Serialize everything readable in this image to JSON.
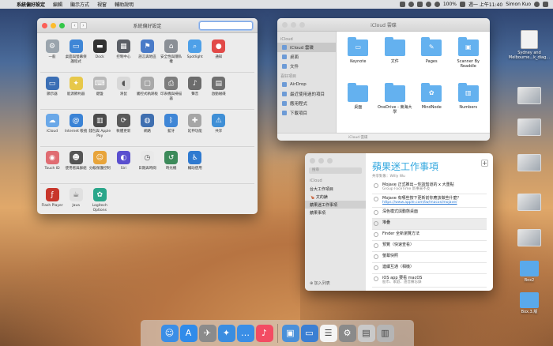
{
  "menubar": {
    "apple": "",
    "items": [
      "系統偏好設定",
      "編輯",
      "顯示方式",
      "視窗",
      "輔助說明"
    ],
    "status_battery": "100%",
    "clock": "週一 上午11:40",
    "user": "Simon Kuo"
  },
  "prefs": {
    "title": "系統偏好設定",
    "back": "‹",
    "forward": "›",
    "sections": [
      [
        {
          "label": "一般",
          "icon": "general-icon",
          "color": "#9aa4ad",
          "glyph": "⚙"
        },
        {
          "label": "桌面與螢幕保護程式",
          "icon": "desktop-icon",
          "color": "#3f86d6",
          "glyph": "▭"
        },
        {
          "label": "Dock",
          "icon": "dock-icon",
          "color": "#333333",
          "glyph": "▬"
        },
        {
          "label": "控制中心",
          "icon": "mission-control-icon",
          "color": "#5b5f66",
          "glyph": "▦"
        },
        {
          "label": "語言與地區",
          "icon": "language-icon",
          "color": "#4a7bc8",
          "glyph": "⚑"
        },
        {
          "label": "安全性與隱私權",
          "icon": "security-icon",
          "color": "#8a8f96",
          "glyph": "⌂"
        },
        {
          "label": "Spotlight",
          "icon": "spotlight-icon",
          "color": "#4ea0e8",
          "glyph": "⌕"
        },
        {
          "label": "通知",
          "icon": "notifications-icon",
          "color": "#e24a48",
          "glyph": "●"
        },
        {
          "label": "",
          "icon": "empty",
          "color": "transparent",
          "glyph": ""
        }
      ],
      [
        {
          "label": "顯示器",
          "icon": "displays-icon",
          "color": "#3b6fb5",
          "glyph": "▭"
        },
        {
          "label": "能源節約器",
          "icon": "energy-icon",
          "color": "#e7c84a",
          "glyph": "✦"
        },
        {
          "label": "鍵盤",
          "icon": "keyboard-icon",
          "color": "#b9b9b9",
          "glyph": "⌨"
        },
        {
          "label": "滑鼠",
          "icon": "mouse-icon",
          "color": "#d8d8d8",
          "glyph": "◖"
        },
        {
          "label": "觸控式軌跡板",
          "icon": "trackpad-icon",
          "color": "#a9a9a9",
          "glyph": "▢"
        },
        {
          "label": "印表機與掃描器",
          "icon": "printers-icon",
          "color": "#7d7d7d",
          "glyph": "⎙"
        },
        {
          "label": "聲音",
          "icon": "sound-icon",
          "color": "#6c6c6c",
          "glyph": "♪"
        },
        {
          "label": "啟動磁碟",
          "icon": "startup-disk-icon",
          "color": "#6f6f6f",
          "glyph": "▤"
        },
        {
          "label": "",
          "icon": "empty",
          "color": "transparent",
          "glyph": ""
        }
      ],
      [
        {
          "label": "iCloud",
          "icon": "icloud-icon",
          "color": "#6aa8e8",
          "glyph": "☁"
        },
        {
          "label": "Internet 帳號",
          "icon": "internet-accounts-icon",
          "color": "#3a83d6",
          "glyph": "@"
        },
        {
          "label": "錢包與 Apple Pay",
          "icon": "wallet-icon",
          "color": "#4b4b4b",
          "glyph": "▥"
        },
        {
          "label": "軟體更新",
          "icon": "software-update-icon",
          "color": "#5a5a5a",
          "glyph": "⟳"
        },
        {
          "label": "網路",
          "icon": "network-icon",
          "color": "#3f6fb0",
          "glyph": "◍"
        },
        {
          "label": "藍牙",
          "icon": "bluetooth-icon",
          "color": "#3f86d6",
          "glyph": "ᛒ"
        },
        {
          "label": "延伸功能",
          "icon": "extensions-icon",
          "color": "#a6a6a6",
          "glyph": "✚"
        },
        {
          "label": "共享",
          "icon": "sharing-icon",
          "color": "#3f8fd6",
          "glyph": "⚠"
        },
        {
          "label": "",
          "icon": "empty",
          "color": "transparent",
          "glyph": ""
        }
      ],
      [
        {
          "label": "Touch ID",
          "icon": "touch-id-icon",
          "color": "#e06c72",
          "glyph": "◉"
        },
        {
          "label": "使用者與群組",
          "icon": "users-icon",
          "color": "#555555",
          "glyph": "☻"
        },
        {
          "label": "分級保護控制",
          "icon": "parental-icon",
          "color": "#e8a43a",
          "glyph": "☺"
        },
        {
          "label": "Siri",
          "icon": "siri-icon",
          "color": "#5a4fcf",
          "glyph": "◐"
        },
        {
          "label": "日期與時間",
          "icon": "date-time-icon",
          "color": "#e9e9e9",
          "glyph": "◷"
        },
        {
          "label": "時光機",
          "icon": "time-machine-icon",
          "color": "#3c8a5a",
          "glyph": "↺"
        },
        {
          "label": "輔助使用",
          "icon": "accessibility-icon",
          "color": "#2f7ad0",
          "glyph": "♿"
        },
        {
          "label": "",
          "icon": "empty",
          "color": "transparent",
          "glyph": ""
        },
        {
          "label": "",
          "icon": "empty",
          "color": "transparent",
          "glyph": ""
        }
      ],
      [
        {
          "label": "Flash Player",
          "icon": "flash-icon",
          "color": "#c8362b",
          "glyph": "ƒ"
        },
        {
          "label": "Java",
          "icon": "java-icon",
          "color": "#e0e0e0",
          "glyph": "☕"
        },
        {
          "label": "Logitech Options",
          "icon": "logitech-icon",
          "color": "#2aa68a",
          "glyph": "✿"
        },
        {
          "label": "",
          "icon": "empty",
          "color": "transparent",
          "glyph": ""
        },
        {
          "label": "",
          "icon": "empty",
          "color": "transparent",
          "glyph": ""
        },
        {
          "label": "",
          "icon": "empty",
          "color": "transparent",
          "glyph": ""
        },
        {
          "label": "",
          "icon": "empty",
          "color": "transparent",
          "glyph": ""
        },
        {
          "label": "",
          "icon": "empty",
          "color": "transparent",
          "glyph": ""
        },
        {
          "label": "",
          "icon": "empty",
          "color": "transparent",
          "glyph": ""
        }
      ]
    ]
  },
  "finder": {
    "title": "iCloud 雲碟",
    "sidebar": [
      {
        "type": "header",
        "label": "iCloud"
      },
      {
        "type": "item",
        "label": "iCloud 雲碟",
        "selected": true
      },
      {
        "type": "item",
        "label": "桌面"
      },
      {
        "type": "item",
        "label": "文件"
      },
      {
        "type": "header",
        "label": "喜好項目"
      },
      {
        "type": "item",
        "label": "AirDrop"
      },
      {
        "type": "item",
        "label": "最近使用過的項目"
      },
      {
        "type": "item",
        "label": "應用程式"
      },
      {
        "type": "item",
        "label": "下載項目"
      }
    ],
    "items": [
      {
        "label": "Keynote",
        "glyph": "▭"
      },
      {
        "label": "文件",
        "glyph": ""
      },
      {
        "label": "Pages",
        "glyph": "✎"
      },
      {
        "label": "Scanner By Readdle",
        "glyph": "▣"
      },
      {
        "label": "桌面",
        "glyph": ""
      },
      {
        "label": "OneDrive - 東海大學",
        "glyph": ""
      },
      {
        "label": "MindNode",
        "glyph": "✿"
      },
      {
        "label": "Numbers",
        "glyph": "▥"
      }
    ],
    "status": "iCloud 雲碟"
  },
  "reminders": {
    "title": "蘋果迷工作事項",
    "subtitle": "共享對象：Willy Wu",
    "search_placeholder": "搜尋",
    "group_icloud": "iCloud",
    "lists": [
      "台大工作項目",
      "🍗 文的錶",
      "蘋果迷工作事項",
      "蘋果事項"
    ],
    "selected_list": 2,
    "add_list": "⊕ 加入列表",
    "tasks": [
      {
        "text": "Mojave 正式推出－你該知道的 x 大重點",
        "note": "Group FaceTime 新事來不及",
        "link": ""
      },
      {
        "text": "Mojave 有哪些按下更新前你應該做些什麼？",
        "note": "",
        "link": "https://www.apple.com/tw/macos/mojave/"
      },
      {
        "text": "深色模式與動態桌面",
        "note": "",
        "link": ""
      },
      {
        "text": "堆疊",
        "note": "",
        "link": ""
      },
      {
        "text": "Finder 全新瀏覽方法",
        "note": "",
        "link": ""
      },
      {
        "text": "預覽（快速查看）",
        "note": "",
        "link": ""
      },
      {
        "text": "螢幕快照",
        "note": "",
        "link": ""
      },
      {
        "text": "連續互通（相機）",
        "note": "",
        "link": ""
      },
      {
        "text": "iOS app 要看 macOS",
        "note": "股市、家庭、語音備忘錄",
        "link": ""
      }
    ]
  },
  "desktop": [
    {
      "label": "Sydney and Melbourne...k_diag...",
      "kind": "doc"
    },
    {
      "label": "",
      "kind": "image"
    },
    {
      "label": "",
      "kind": "image"
    },
    {
      "label": "",
      "kind": "image"
    },
    {
      "label": "",
      "kind": "image"
    },
    {
      "label": "",
      "kind": "image"
    },
    {
      "label": "Box2",
      "kind": "folder"
    },
    {
      "label": "Box.3.版",
      "kind": "folder"
    }
  ],
  "dock": [
    {
      "name": "finder-icon",
      "glyph": "☺",
      "color": "#3a8ee6"
    },
    {
      "name": "app-store-icon",
      "glyph": "A",
      "color": "#2f8bea"
    },
    {
      "name": "launchpad-icon",
      "glyph": "✈",
      "color": "#8b8b8b"
    },
    {
      "name": "safari-icon",
      "glyph": "✦",
      "color": "#3a8de0"
    },
    {
      "name": "messages-icon",
      "glyph": "…",
      "color": "#3a8ee6"
    },
    {
      "name": "music-icon",
      "glyph": "♪",
      "color": "#f34c63"
    },
    {
      "sep": true
    },
    {
      "name": "desktop-folder-icon",
      "glyph": "▣",
      "color": "#4a90d9"
    },
    {
      "name": "keynote-icon",
      "glyph": "▭",
      "color": "#3b7fd3"
    },
    {
      "name": "reminders-icon",
      "glyph": "☰",
      "color": "#f4f4f4"
    },
    {
      "name": "system-preferences-icon",
      "glyph": "⚙",
      "color": "#8a8a8a"
    },
    {
      "name": "preview-icon",
      "glyph": "▤",
      "color": "#c9c9c9"
    },
    {
      "name": "trash-icon",
      "glyph": "▥",
      "color": "#b5b5b5"
    }
  ]
}
